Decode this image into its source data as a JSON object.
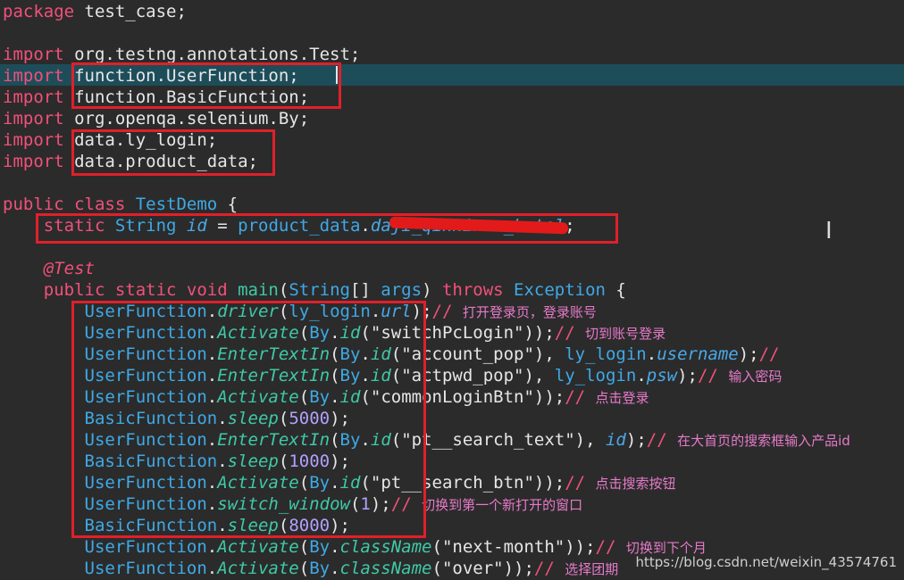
{
  "colors": {
    "background": "#2b2b2b",
    "current_line": "#1e4d5a",
    "annotation_box": "#e0202a"
  },
  "code_lines": [
    [
      {
        "t": "package",
        "k": "kw"
      },
      {
        "t": " test_case;",
        "k": "pkg"
      }
    ],
    [],
    [
      {
        "t": "import",
        "k": "kw"
      },
      {
        "t": " org.testng.annotations.Test;",
        "k": "pkg"
      }
    ],
    [
      {
        "t": "import",
        "k": "kw"
      },
      {
        "t": " function.UserFunction;",
        "k": "pkg"
      }
    ],
    [
      {
        "t": "import",
        "k": "kw"
      },
      {
        "t": " function.BasicFunction;",
        "k": "pkg"
      }
    ],
    [
      {
        "t": "import",
        "k": "kw"
      },
      {
        "t": " org.openqa.selenium.By;",
        "k": "pkg"
      }
    ],
    [
      {
        "t": "import",
        "k": "kw"
      },
      {
        "t": " data.ly_login;",
        "k": "pkg"
      }
    ],
    [
      {
        "t": "import",
        "k": "kw"
      },
      {
        "t": " data.product_data;",
        "k": "pkg"
      }
    ],
    [],
    [
      {
        "t": "public class ",
        "k": "kw"
      },
      {
        "t": "TestDemo",
        "k": "cls"
      },
      {
        "t": " {",
        "k": "pkg"
      }
    ],
    [
      {
        "t": "    static ",
        "k": "kw"
      },
      {
        "t": "String ",
        "k": "type"
      },
      {
        "t": "id",
        "k": "v"
      },
      {
        "t": " = ",
        "k": "pkg"
      },
      {
        "t": "product_data",
        "k": "type"
      },
      {
        "t": ".",
        "k": "pkg"
      },
      {
        "t": "daji_qinhinna_hotel",
        "k": "v"
      },
      {
        "t": ";",
        "k": "pkg"
      }
    ],
    [],
    [
      {
        "t": "    @Test",
        "k": "ann"
      }
    ],
    [
      {
        "t": "    public static void ",
        "k": "kw"
      },
      {
        "t": "main",
        "k": "fn"
      },
      {
        "t": "(",
        "k": "pkg"
      },
      {
        "t": "String",
        "k": "type"
      },
      {
        "t": "[] ",
        "k": "pkg"
      },
      {
        "t": "args",
        "k": "type"
      },
      {
        "t": ") ",
        "k": "pkg"
      },
      {
        "t": "throws ",
        "k": "kw"
      },
      {
        "t": "Exception",
        "k": "type"
      },
      {
        "t": " {",
        "k": "pkg"
      }
    ],
    [
      {
        "t": "        UserFunction",
        "k": "type"
      },
      {
        "t": ".",
        "k": "pkg"
      },
      {
        "t": "driver",
        "k": "m"
      },
      {
        "t": "(",
        "k": "pkg"
      },
      {
        "t": "ly_login",
        "k": "type"
      },
      {
        "t": ".",
        "k": "pkg"
      },
      {
        "t": "url",
        "k": "v"
      },
      {
        "t": ");",
        "k": "pkg"
      },
      {
        "t": "// ",
        "k": "kw"
      },
      {
        "t": "打开登录页，登录账号",
        "k": "c"
      }
    ],
    [
      {
        "t": "        UserFunction",
        "k": "type"
      },
      {
        "t": ".",
        "k": "pkg"
      },
      {
        "t": "Activate",
        "k": "m"
      },
      {
        "t": "(",
        "k": "pkg"
      },
      {
        "t": "By",
        "k": "type"
      },
      {
        "t": ".",
        "k": "pkg"
      },
      {
        "t": "id",
        "k": "m"
      },
      {
        "t": "(\"switchPcLogin\"));",
        "k": "pkg"
      },
      {
        "t": "// ",
        "k": "kw"
      },
      {
        "t": "切到账号登录",
        "k": "c"
      }
    ],
    [
      {
        "t": "        UserFunction",
        "k": "type"
      },
      {
        "t": ".",
        "k": "pkg"
      },
      {
        "t": "EnterTextIn",
        "k": "m"
      },
      {
        "t": "(",
        "k": "pkg"
      },
      {
        "t": "By",
        "k": "type"
      },
      {
        "t": ".",
        "k": "pkg"
      },
      {
        "t": "id",
        "k": "m"
      },
      {
        "t": "(\"account_pop\"), ",
        "k": "pkg"
      },
      {
        "t": "ly_login",
        "k": "type"
      },
      {
        "t": ".",
        "k": "pkg"
      },
      {
        "t": "username",
        "k": "v"
      },
      {
        "t": ");",
        "k": "pkg"
      },
      {
        "t": "//",
        "k": "kw"
      }
    ],
    [
      {
        "t": "        UserFunction",
        "k": "type"
      },
      {
        "t": ".",
        "k": "pkg"
      },
      {
        "t": "EnterTextIn",
        "k": "m"
      },
      {
        "t": "(",
        "k": "pkg"
      },
      {
        "t": "By",
        "k": "type"
      },
      {
        "t": ".",
        "k": "pkg"
      },
      {
        "t": "id",
        "k": "m"
      },
      {
        "t": "(\"actpwd_pop\"), ",
        "k": "pkg"
      },
      {
        "t": "ly_login",
        "k": "type"
      },
      {
        "t": ".",
        "k": "pkg"
      },
      {
        "t": "psw",
        "k": "v"
      },
      {
        "t": ");",
        "k": "pkg"
      },
      {
        "t": "// ",
        "k": "kw"
      },
      {
        "t": "输入密码",
        "k": "c"
      }
    ],
    [
      {
        "t": "        UserFunction",
        "k": "type"
      },
      {
        "t": ".",
        "k": "pkg"
      },
      {
        "t": "Activate",
        "k": "m"
      },
      {
        "t": "(",
        "k": "pkg"
      },
      {
        "t": "By",
        "k": "type"
      },
      {
        "t": ".",
        "k": "pkg"
      },
      {
        "t": "id",
        "k": "m"
      },
      {
        "t": "(\"commonLoginBtn\"));",
        "k": "pkg"
      },
      {
        "t": "// ",
        "k": "kw"
      },
      {
        "t": "点击登录",
        "k": "c"
      }
    ],
    [
      {
        "t": "        BasicFunction",
        "k": "type"
      },
      {
        "t": ".",
        "k": "pkg"
      },
      {
        "t": "sleep",
        "k": "m"
      },
      {
        "t": "(",
        "k": "pkg"
      },
      {
        "t": "5000",
        "k": "n"
      },
      {
        "t": ");",
        "k": "pkg"
      }
    ],
    [
      {
        "t": "        UserFunction",
        "k": "type"
      },
      {
        "t": ".",
        "k": "pkg"
      },
      {
        "t": "EnterTextIn",
        "k": "m"
      },
      {
        "t": "(",
        "k": "pkg"
      },
      {
        "t": "By",
        "k": "type"
      },
      {
        "t": ".",
        "k": "pkg"
      },
      {
        "t": "id",
        "k": "m"
      },
      {
        "t": "(\"pt__search_text\"), ",
        "k": "pkg"
      },
      {
        "t": "id",
        "k": "v"
      },
      {
        "t": ");",
        "k": "pkg"
      },
      {
        "t": "// ",
        "k": "kw"
      },
      {
        "t": "在大首页的搜索框输入产品id",
        "k": "c"
      }
    ],
    [
      {
        "t": "        BasicFunction",
        "k": "type"
      },
      {
        "t": ".",
        "k": "pkg"
      },
      {
        "t": "sleep",
        "k": "m"
      },
      {
        "t": "(",
        "k": "pkg"
      },
      {
        "t": "1000",
        "k": "n"
      },
      {
        "t": ");",
        "k": "pkg"
      }
    ],
    [
      {
        "t": "        UserFunction",
        "k": "type"
      },
      {
        "t": ".",
        "k": "pkg"
      },
      {
        "t": "Activate",
        "k": "m"
      },
      {
        "t": "(",
        "k": "pkg"
      },
      {
        "t": "By",
        "k": "type"
      },
      {
        "t": ".",
        "k": "pkg"
      },
      {
        "t": "id",
        "k": "m"
      },
      {
        "t": "(\"pt__search_btn\"));",
        "k": "pkg"
      },
      {
        "t": "// ",
        "k": "kw"
      },
      {
        "t": "点击搜索按钮",
        "k": "c"
      }
    ],
    [
      {
        "t": "        UserFunction",
        "k": "type"
      },
      {
        "t": ".",
        "k": "pkg"
      },
      {
        "t": "switch_window",
        "k": "m"
      },
      {
        "t": "(",
        "k": "pkg"
      },
      {
        "t": "1",
        "k": "n"
      },
      {
        "t": ");",
        "k": "pkg"
      },
      {
        "t": "// ",
        "k": "kw"
      },
      {
        "t": "切换到第一个新打开的窗口",
        "k": "c"
      }
    ],
    [
      {
        "t": "        BasicFunction",
        "k": "type"
      },
      {
        "t": ".",
        "k": "pkg"
      },
      {
        "t": "sleep",
        "k": "m"
      },
      {
        "t": "(",
        "k": "pkg"
      },
      {
        "t": "8000",
        "k": "n"
      },
      {
        "t": ");",
        "k": "pkg"
      }
    ],
    [
      {
        "t": "        UserFunction",
        "k": "type"
      },
      {
        "t": ".",
        "k": "pkg"
      },
      {
        "t": "Activate",
        "k": "m"
      },
      {
        "t": "(",
        "k": "pkg"
      },
      {
        "t": "By",
        "k": "type"
      },
      {
        "t": ".",
        "k": "pkg"
      },
      {
        "t": "className",
        "k": "m"
      },
      {
        "t": "(\"next-month\"));",
        "k": "pkg"
      },
      {
        "t": "// ",
        "k": "kw"
      },
      {
        "t": "切换到下个月",
        "k": "c"
      }
    ],
    [
      {
        "t": "        UserFunction",
        "k": "type"
      },
      {
        "t": ".",
        "k": "pkg"
      },
      {
        "t": "Activate",
        "k": "m"
      },
      {
        "t": "(",
        "k": "pkg"
      },
      {
        "t": "By",
        "k": "type"
      },
      {
        "t": ".",
        "k": "pkg"
      },
      {
        "t": "className",
        "k": "m"
      },
      {
        "t": "(\"over\"));",
        "k": "pkg"
      },
      {
        "t": "// ",
        "k": "kw"
      },
      {
        "t": "选择团期",
        "k": "c"
      }
    ]
  ],
  "watermark": "https://blog.csdn.net/weixin_43574761"
}
